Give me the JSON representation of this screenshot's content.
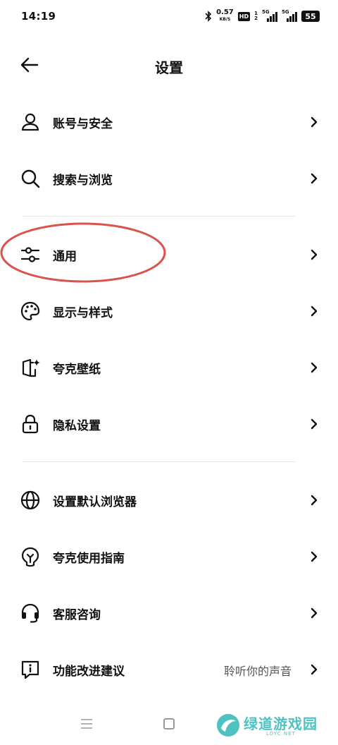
{
  "status_bar": {
    "time": "14:19",
    "net_speed_value": "0.57",
    "net_speed_unit": "KB/S",
    "hd_label": "HD",
    "hd_sim1": "1",
    "hd_sim2": "2",
    "sig1_label": "5G",
    "sig2_label": "5G",
    "battery": "55",
    "bluetooth_icon": "bluetooth-icon"
  },
  "header": {
    "title": "设置",
    "back_icon": "arrow-left-icon"
  },
  "menu_groups": [
    [
      {
        "label": "账号与安全",
        "icon": "user-icon"
      },
      {
        "label": "搜索与浏览",
        "icon": "search-icon"
      }
    ],
    [
      {
        "label": "通用",
        "icon": "sliders-icon"
      },
      {
        "label": "显示与样式",
        "icon": "palette-icon"
      },
      {
        "label": "夸克壁纸",
        "icon": "wallpaper-sparkle-icon"
      },
      {
        "label": "隐私设置",
        "icon": "lock-icon"
      }
    ],
    [
      {
        "label": "设置默认浏览器",
        "icon": "globe-icon"
      },
      {
        "label": "夸克使用指南",
        "icon": "bulb-icon"
      },
      {
        "label": "客服咨询",
        "icon": "headset-icon"
      },
      {
        "label": "功能改进建议",
        "icon": "feedback-icon",
        "hint": "聆听你的声音"
      }
    ]
  ],
  "annotation": {
    "color": "#d9534f"
  },
  "watermark": {
    "text": "绿道游戏园",
    "sub": "LDYC.NET",
    "color": "#4ec2c0"
  },
  "colors": {
    "text": "#111111",
    "divider": "#e8e8e8",
    "hint": "#555555"
  }
}
